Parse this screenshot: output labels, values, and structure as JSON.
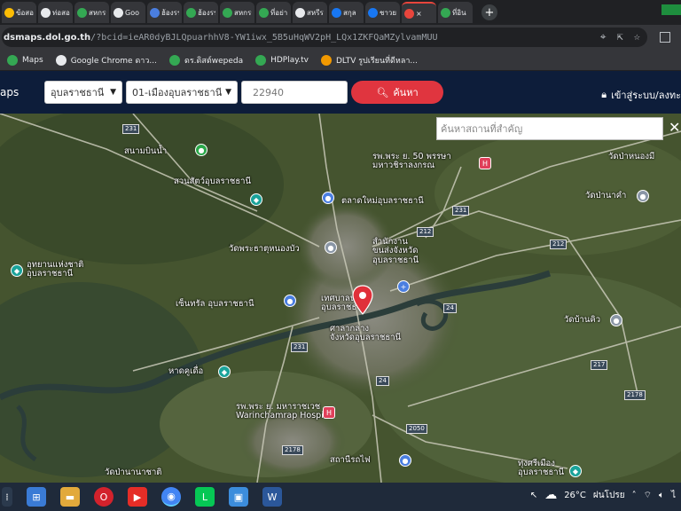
{
  "browser": {
    "tabs": [
      {
        "label": "ข้อสอ",
        "icon": "document-icon",
        "color": "#fbbc04"
      },
      {
        "label": "ท่อสอ",
        "icon": "globe-icon",
        "color": "#e8eaed"
      },
      {
        "label": "สหกรร",
        "icon": "green-app-icon",
        "color": "#34a853"
      },
      {
        "label": "Goo",
        "icon": "map-pin-icon",
        "color": "#e8eaed"
      },
      {
        "label": "ฮ้องรร",
        "icon": "bookmark-icon",
        "color": "#4a7ee0"
      },
      {
        "label": "ฮ้องรร",
        "icon": "green-app-icon",
        "color": "#34a853"
      },
      {
        "label": "สหกรร",
        "icon": "green-app-icon",
        "color": "#34a853"
      },
      {
        "label": "ที่อย่า",
        "icon": "green-app-icon",
        "color": "#34a853"
      },
      {
        "label": "สหรีร",
        "icon": "globe-icon",
        "color": "#e8eaed"
      },
      {
        "label": "สกุล",
        "icon": "facebook-icon",
        "color": "#1877f2"
      },
      {
        "label": "ชาวย",
        "icon": "facebook-icon",
        "color": "#1877f2"
      },
      {
        "label": "×",
        "icon": "map-pin-icon",
        "color": "#e8453c",
        "active": true
      },
      {
        "label": "ที่อิน",
        "icon": "green-app-icon",
        "color": "#34a853"
      }
    ],
    "new_tab": "+",
    "url_host": "dsmaps.dol.go.th",
    "url_path": "/?bcid=ieAR0dyBJLQpuarhhV8-YW1iwx_5B5uHqWV2pH_LQx1ZKFQaMZylvamMUU",
    "bookmarks": [
      {
        "label": "Maps",
        "color": "#34a853"
      },
      {
        "label": "Google Chrome ดาว...",
        "color": "#e8eaed"
      },
      {
        "label": "ดร.ดิสต์wepeda",
        "color": "#34a853"
      },
      {
        "label": "HDPlay.tv",
        "color": "#34a853"
      },
      {
        "label": "DLTV รูปเรียนที่ดีหลา...",
        "color": "#f29900"
      }
    ]
  },
  "app": {
    "brand": "aps",
    "province": "อุบลราชธานี",
    "district": "01-เมืองอุบลราชธานี",
    "zip": "22940",
    "search_label": "ค้นหา",
    "login_label": "เข้าสู่ระบบ/ลงทะ",
    "place_search_placeholder": "ค้นหาสถานที่สำคัญ",
    "close": "✕"
  },
  "map": {
    "labels": [
      {
        "id": "l1",
        "text": "สนามบินน้ำ"
      },
      {
        "id": "l2",
        "text": "สวนสัตว์อุบลราชธานี"
      },
      {
        "id": "l3",
        "text": "รพ.พระ ย. 50 พรรษา\nมหาวชิราลงกรณ"
      },
      {
        "id": "l4",
        "text": "วัดป่าหนองมี"
      },
      {
        "id": "l5",
        "text": "ตลาดใหม่อุบลราชธานี"
      },
      {
        "id": "l6",
        "text": "วัดป่านาคำ"
      },
      {
        "id": "l7",
        "text": "วัดพระธาตุหนองบัว"
      },
      {
        "id": "l8",
        "text": "สำนักงาน\nขนส่งจังหวัด\nอุบลราชธานี"
      },
      {
        "id": "l9",
        "text": "อุทยานแห่งชาติ\nอุบลราชธานี"
      },
      {
        "id": "l10",
        "text": "เซ็นทรัล อุบลราชธานี"
      },
      {
        "id": "l11",
        "text": "เทศบาลนคร\nอุบลราชธานี"
      },
      {
        "id": "l12",
        "text": "ศาลากลาง\nจังหวัดอุบลราชธานี"
      },
      {
        "id": "l13",
        "text": "วัดบ้านคิว"
      },
      {
        "id": "l14",
        "text": "หาดคูเดื่อ"
      },
      {
        "id": "l15",
        "text": "รพ.พระ ย. มหาราชเวช\nWarinchamrap Hospital"
      },
      {
        "id": "l16",
        "text": "วัดป่านานาชาติ"
      },
      {
        "id": "l17",
        "text": "สถานีรถไฟ"
      },
      {
        "id": "l18",
        "text": "ทุ่งศรีเมือง\nอุบลราชธานี"
      }
    ],
    "roads": [
      "231",
      "231",
      "212",
      "212",
      "24",
      "231",
      "217",
      "24",
      "2178",
      "2050",
      "2178"
    ]
  },
  "taskbar": {
    "temp": "26°C",
    "weather": "ฝนโปรย",
    "apps": [
      "windows-icon",
      "file-explorer-icon",
      "opera-icon",
      "youtube-icon",
      "chrome-icon",
      "line-icon",
      "photos-icon",
      "word-icon"
    ]
  }
}
